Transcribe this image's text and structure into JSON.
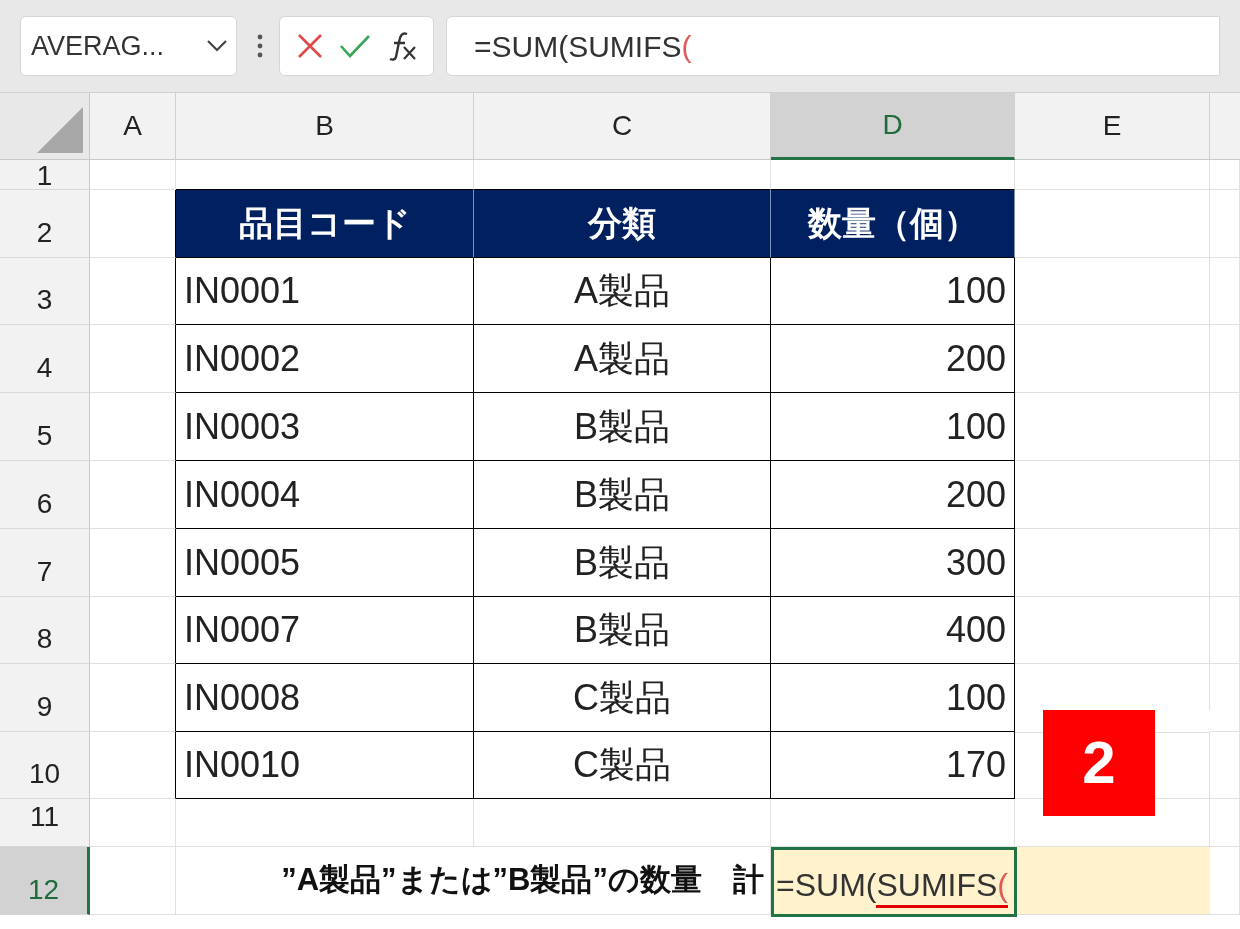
{
  "name_box": {
    "value": "AVERAG..."
  },
  "formula_bar": {
    "segments": [
      {
        "text": "=SUM(SUMIFS",
        "color": "#333333"
      },
      {
        "text": "(",
        "color": "#e05a5a"
      }
    ]
  },
  "columns": [
    {
      "label": "A",
      "selected": false
    },
    {
      "label": "B",
      "selected": false
    },
    {
      "label": "C",
      "selected": false
    },
    {
      "label": "D",
      "selected": true
    },
    {
      "label": "E",
      "selected": false
    }
  ],
  "rows": [
    {
      "label": "1",
      "selected": false
    },
    {
      "label": "2",
      "selected": false
    },
    {
      "label": "3",
      "selected": false
    },
    {
      "label": "4",
      "selected": false
    },
    {
      "label": "5",
      "selected": false
    },
    {
      "label": "6",
      "selected": false
    },
    {
      "label": "7",
      "selected": false
    },
    {
      "label": "8",
      "selected": false
    },
    {
      "label": "9",
      "selected": false
    },
    {
      "label": "10",
      "selected": false
    },
    {
      "label": "11",
      "selected": false
    },
    {
      "label": "12",
      "selected": true
    }
  ],
  "table": {
    "headers": [
      "品目コード",
      "分類",
      "数量（個）"
    ],
    "rows": [
      [
        "IN0001",
        "A製品",
        "100"
      ],
      [
        "IN0002",
        "A製品",
        "200"
      ],
      [
        "IN0003",
        "B製品",
        "100"
      ],
      [
        "IN0004",
        "B製品",
        "200"
      ],
      [
        "IN0005",
        "B製品",
        "300"
      ],
      [
        "IN0007",
        "B製品",
        "400"
      ],
      [
        "IN0008",
        "C製品",
        "100"
      ],
      [
        "IN0010",
        "C製品",
        "170"
      ]
    ]
  },
  "total_label": "”A製品”または”B製品”の数量　計",
  "active_cell": {
    "segments": [
      {
        "text": "=SUM(",
        "color": "#333333",
        "underlined": false
      },
      {
        "text": "SUMIFS",
        "color": "#333333",
        "underlined": true
      },
      {
        "text": "(",
        "color": "#e05a5a",
        "underlined": true
      }
    ]
  },
  "step_badge": "2"
}
